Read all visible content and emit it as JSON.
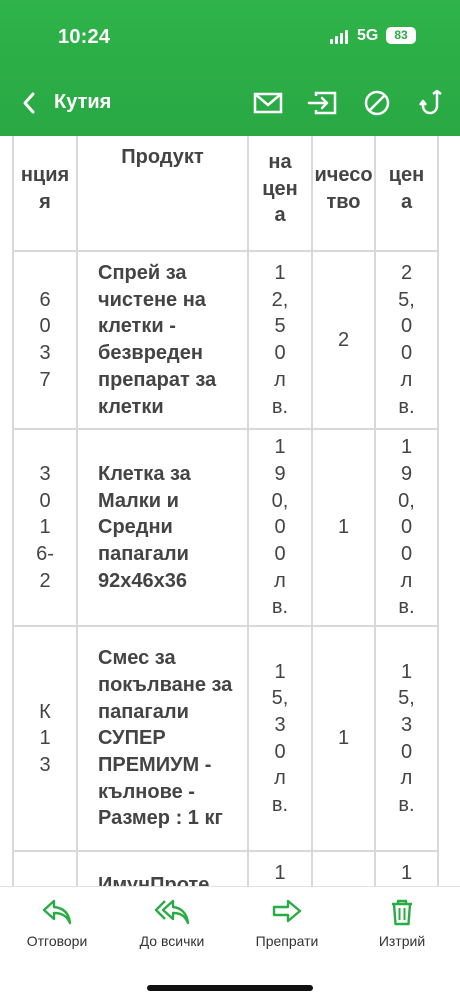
{
  "status": {
    "time": "10:24",
    "network": "5G",
    "battery": "83"
  },
  "header": {
    "title": "Кутия"
  },
  "icons": {
    "back": "chevron-left-icon",
    "mail": "mail-icon",
    "move": "move-to-icon",
    "block": "block-icon",
    "hook": "hook-icon"
  },
  "table": {
    "headers": [
      "нция\nя",
      "Продукт",
      "на\nцен\nа",
      "ичесо\nтво",
      "цен\nа"
    ],
    "rows": [
      {
        "code": "6\n0\n3\n7",
        "name": "Спрей за чистене на клетки - безвреден препарат за клетки",
        "price": "1\n2,\n5\n0\nл\nв.",
        "qty": "2",
        "total": "2\n5,\n0\n0\nл\nв."
      },
      {
        "code": "3\n0\n1\n6-\n2",
        "name": "Клетка за Малки и Средни папагали 92x46x36",
        "price": "1\n9\n0,\n0\n0\nл\nв.",
        "qty": "1",
        "total": "1\n9\n0,\n0\n0\nл\nв."
      },
      {
        "code": "К\n1\n3",
        "name": "Смес за покълване за папагали СУПЕР ПРЕМИУМ - кълнове - Размер : 1 кг",
        "price": "1\n5,\n3\n0\nл\nв.",
        "qty": "1",
        "total": "1\n5,\n3\n0\nл\nв."
      },
      {
        "code": "",
        "name": "ИмунПроте",
        "price": "1\n5",
        "qty": "",
        "total": "1\n5"
      }
    ]
  },
  "toolbar": {
    "reply": "Отговори",
    "reply_all": "До всички",
    "forward": "Препрати",
    "delete": "Изтрий"
  },
  "colors": {
    "brand": "#2aac45",
    "icon": "#2aac45",
    "text": "#444444"
  }
}
